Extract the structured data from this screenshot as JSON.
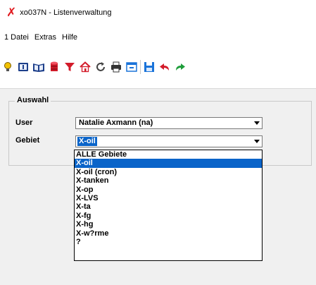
{
  "window": {
    "title": "xo037N - Listenverwaltung",
    "app_icon": "red-x-icon",
    "accent": "#e0191e"
  },
  "menu": {
    "items": [
      "1 Datei",
      "Extras",
      "Hilfe"
    ]
  },
  "toolbar": {
    "icons": [
      "lightbulb-icon",
      "info-book-icon",
      "open-book-icon",
      "database-icon",
      "filter-icon",
      "house-icon",
      "refresh-icon",
      "print-icon",
      "window-icon",
      "save-icon",
      "undo-icon",
      "redo-icon"
    ]
  },
  "auswahl": {
    "legend": "Auswahl",
    "user": {
      "label": "User",
      "value": "Natalie Axmann (na)"
    },
    "gebiet": {
      "label": "Gebiet",
      "value": "X-oil"
    }
  },
  "dropdown": {
    "selected_index": 1,
    "options": [
      "ALLE Gebiete",
      "X-oil",
      "X-oil (cron)",
      "X-tanken",
      "X-op",
      "X-LVS",
      "X-ta",
      "X-fg",
      "X-hg",
      "X-w?rme",
      "?"
    ]
  },
  "colors": {
    "selection": "#0a64c9",
    "client_bg": "#f0f0f0"
  }
}
